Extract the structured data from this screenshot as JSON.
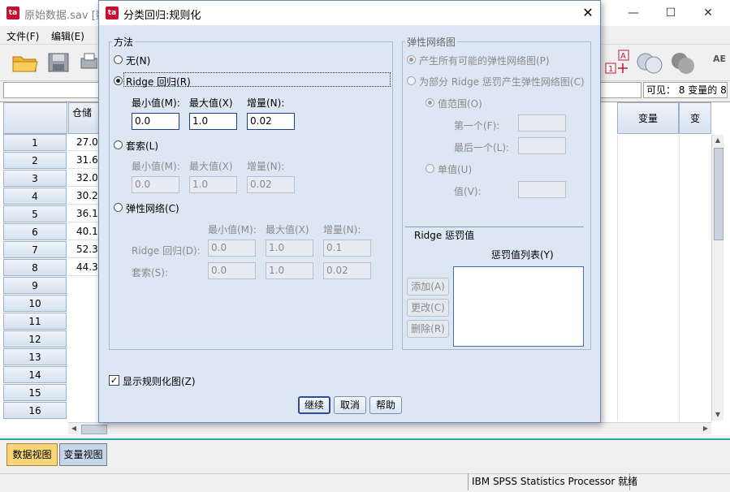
{
  "main_window": {
    "title": "原始数据.sav [数",
    "minimize": "—",
    "maximize": "☐",
    "close": "✕",
    "menu": [
      "文件(F)",
      "编辑(E)"
    ],
    "visible_label": "可见： 8 变量的 8",
    "column_header_first": "仓储",
    "column_header_var": "变量",
    "column_header_var2": "变",
    "row_numbers": [
      "1",
      "2",
      "3",
      "4",
      "5",
      "6",
      "7",
      "8",
      "9",
      "10",
      "11",
      "12",
      "13",
      "14",
      "15",
      "16"
    ],
    "cell_values": [
      "27.0",
      "31.6",
      "32.0",
      "30.2",
      "36.1",
      "40.1",
      "52.3",
      "44.3"
    ],
    "tabs": {
      "data_view": "数据视图",
      "variable_view": "变量视图"
    },
    "status": "IBM SPSS Statistics Processor 就绪"
  },
  "dialog": {
    "title": "分类回归:规则化",
    "close": "✕",
    "method": {
      "group_label": "方法",
      "none_option": "无(N)",
      "ridge_option": "Ridge 回归(R)",
      "ridge_min_label": "最小值(M):",
      "ridge_max_label": "最大值(X)",
      "ridge_inc_label": "增量(N):",
      "ridge_min_value": "0.0",
      "ridge_max_value": "1.0",
      "ridge_inc_value": "0.02",
      "lasso_option": "套索(L)",
      "lasso_min_label": "最小值(M):",
      "lasso_max_label": "最大值(X)",
      "lasso_inc_label": "增量(N):",
      "lasso_min_value": "0.0",
      "lasso_max_value": "1.0",
      "lasso_inc_value": "0.02",
      "elastic_option": "弹性网络(C)",
      "elastic_min_label": "最小值(M):",
      "elastic_max_label": "最大值(X)",
      "elastic_inc_label": "增量(N):",
      "elastic_ridge_label": "Ridge 回归(D):",
      "elastic_lasso_label": "套索(S):",
      "elastic_ridge_min": "0.0",
      "elastic_ridge_max": "1.0",
      "elastic_ridge_inc": "0.1",
      "elastic_lasso_min": "0.0",
      "elastic_lasso_max": "1.0",
      "elastic_lasso_inc": "0.02"
    },
    "elastic_plot": {
      "group_label": "弹性网络图",
      "all_option": "产生所有可能的弹性网络图(P)",
      "some_option": "为部分 Ridge 惩罚产生弹性网络图(C)",
      "range_option": "值范围(O)",
      "first_label": "第一个(F):",
      "last_label": "最后一个(L):",
      "single_option": "单值(U)",
      "value_label": "值(V):"
    },
    "ridge_penalty": {
      "group_label": "Ridge 惩罚值",
      "list_label": "惩罚值列表(Y)",
      "add": "添加(A)",
      "change": "更改(C)",
      "remove": "删除(R)"
    },
    "show_plot_label": "显示规则化图(Z)",
    "buttons": {
      "continue": "继续",
      "cancel": "取消",
      "help": "帮助"
    }
  }
}
